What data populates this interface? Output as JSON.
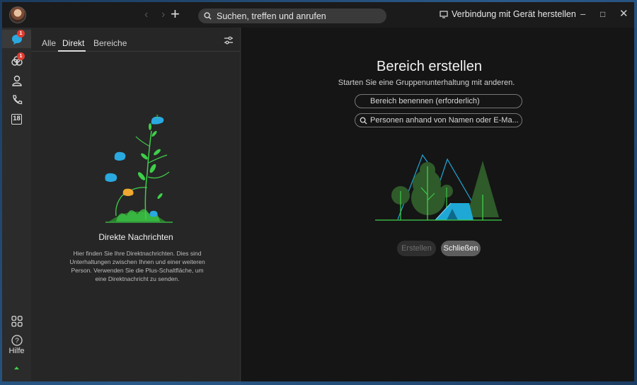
{
  "titlebar": {
    "back_icon": "chevron-left-icon",
    "forward_icon": "chevron-right-icon",
    "new_icon": "plus-icon",
    "search_placeholder": "Suchen, treffen und anrufen",
    "connect_label": "Verbindung mit Gerät herstellen"
  },
  "rail": {
    "items": [
      {
        "icon": "chat-icon",
        "badge": "1"
      },
      {
        "icon": "teams-icon",
        "badge": "1"
      },
      {
        "icon": "contacts-icon"
      },
      {
        "icon": "phone-icon"
      },
      {
        "icon": "calendar-icon",
        "text": "18"
      }
    ],
    "apps_icon": "apps-grid-icon",
    "help_label": "Hilfe"
  },
  "panel": {
    "tabs": [
      "Alle",
      "Direkt",
      "Bereiche"
    ],
    "active_tab": "Direkt",
    "empty_title": "Direkte Nachrichten",
    "empty_desc": "Hier finden Sie Ihre Direktnachrichten. Dies sind Unterhaltungen zwischen Ihnen und einer weiteren Person. Verwenden Sie die Plus-Schaltfläche, um eine Direktnachricht zu senden."
  },
  "main": {
    "title": "Bereich erstellen",
    "subtitle": "Starten Sie eine Gruppenunterhaltung mit anderen.",
    "name_placeholder": "Bereich benennen (erforderlich)",
    "people_placeholder": "Personen anhand von Namen oder E-Ma...",
    "create_label": "Erstellen",
    "close_label": "Schließen"
  },
  "colors": {
    "accent_green": "#3ecf4a",
    "bird_blue": "#2aa8e0",
    "tent_blue": "#1fa8d6",
    "badge_red": "#e03c31"
  }
}
